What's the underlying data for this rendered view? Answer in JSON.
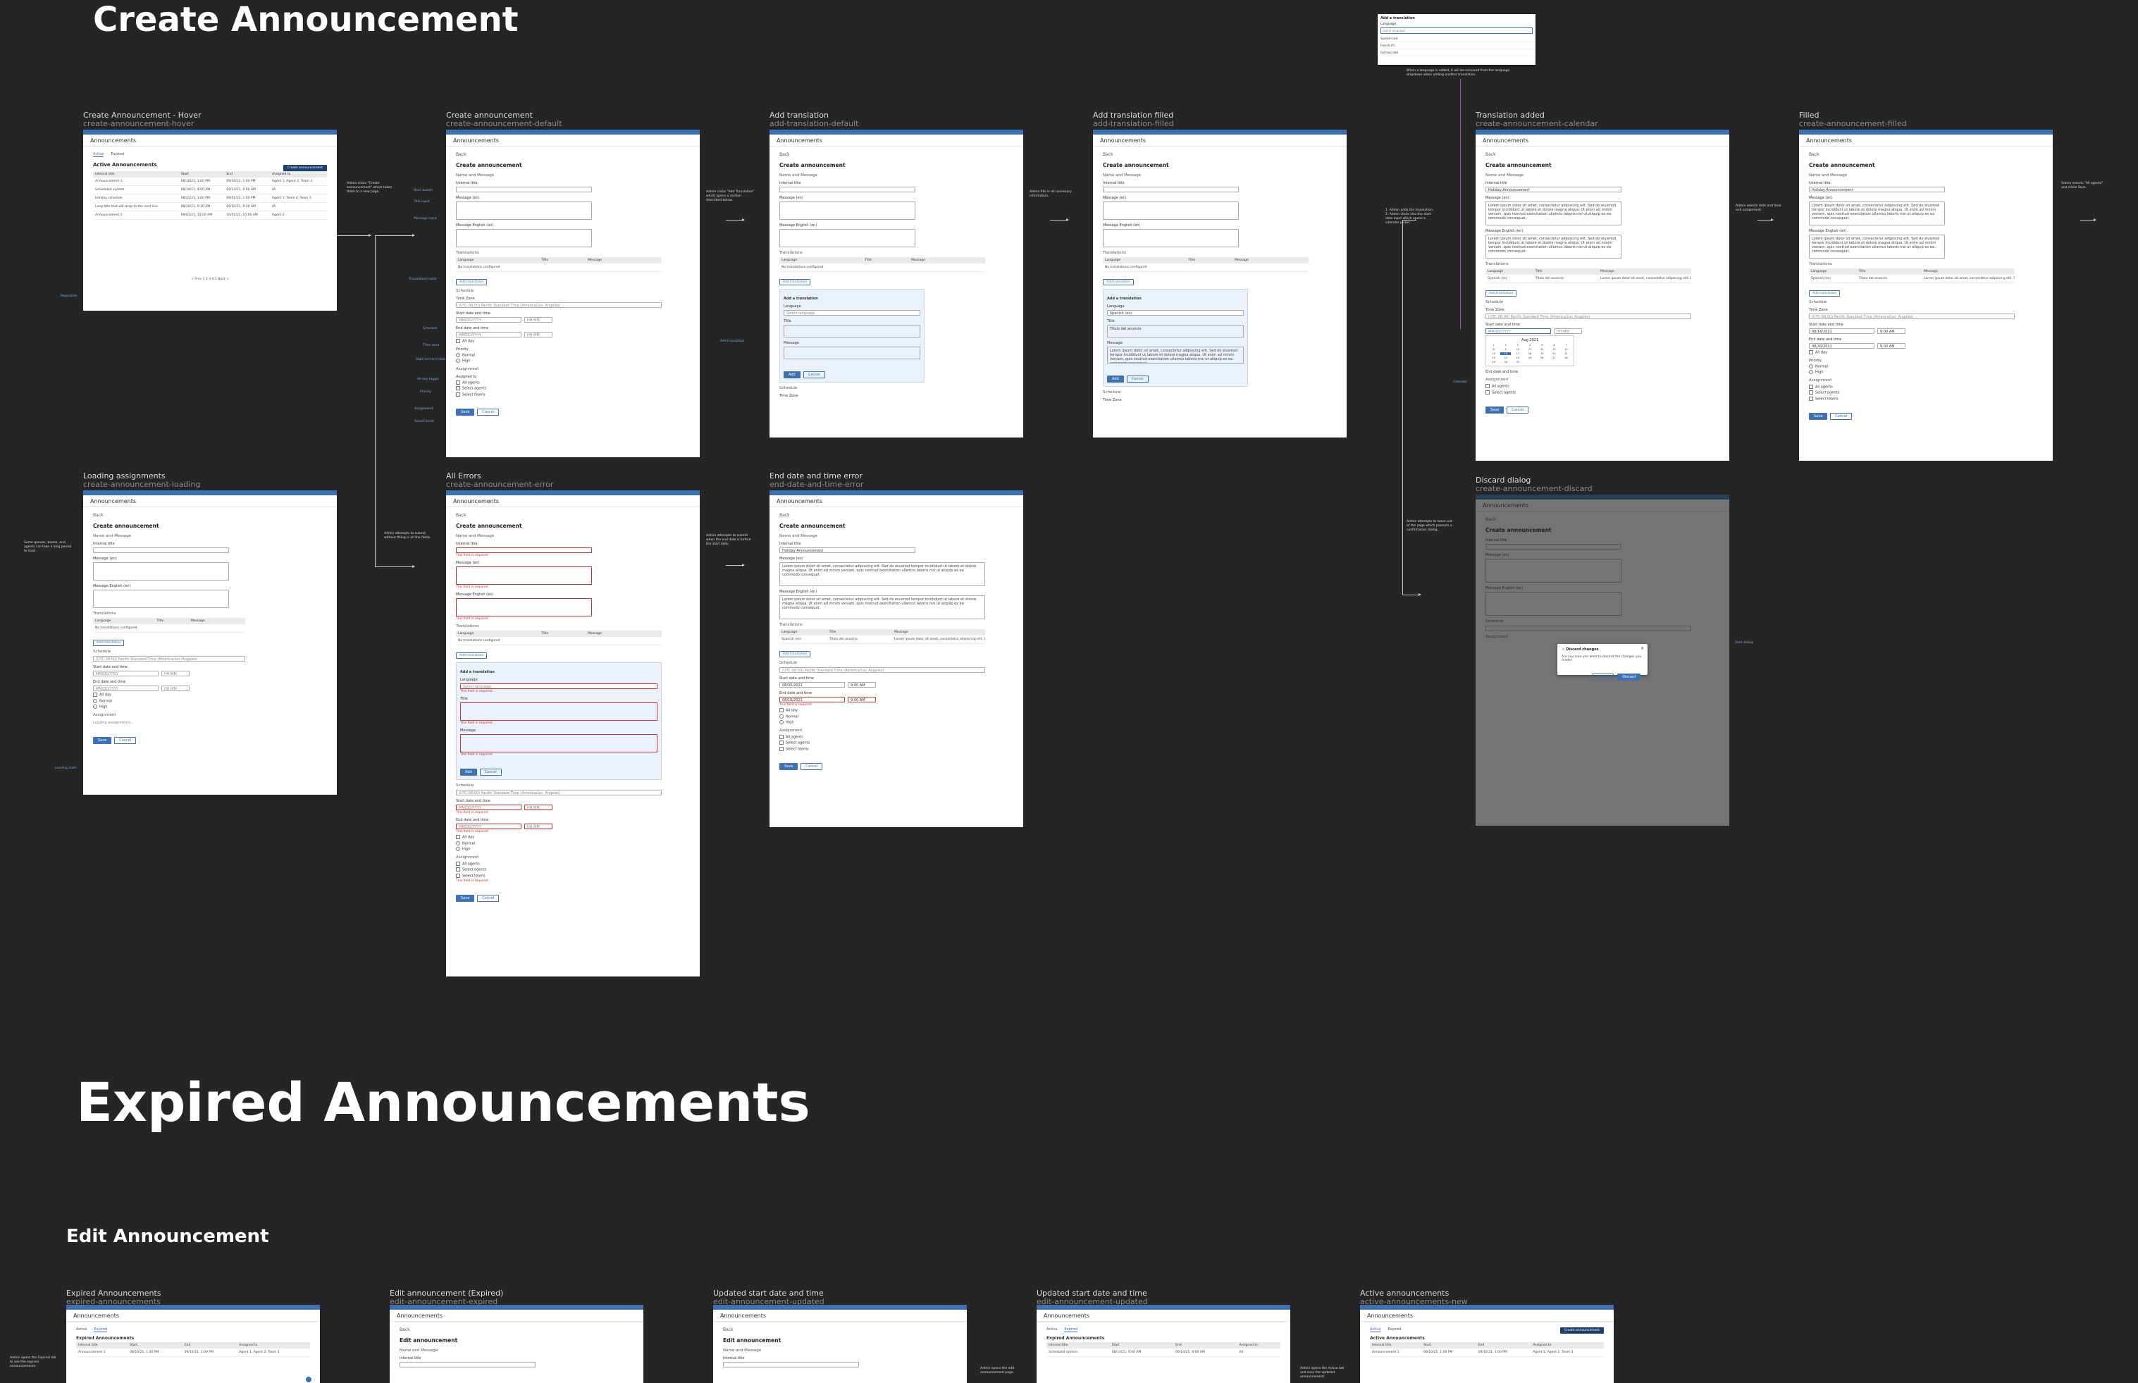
{
  "headings": {
    "create": "Create Announcement",
    "expired": "Expired Announcements",
    "edit": "Edit Announcement"
  },
  "common": {
    "page_title": "Announcements",
    "back": "Back",
    "create_title": "Create announcement",
    "edit_title": "Edit announcement",
    "name_message": "Name and Message",
    "internal_title": "Internal title",
    "message_en": "Message (en)",
    "message_english_en": "Message English (en)",
    "translations": "Translations",
    "col_language": "Language",
    "col_title": "Title",
    "col_message": "Message",
    "no_translations": "No translations configured",
    "add_translation_btn": "Add translation",
    "add_a_translation": "Add a translation",
    "language": "Language",
    "title": "Title",
    "message": "Message",
    "schedule": "Schedule",
    "time_zone": "Time Zone",
    "start_date": "Start date and time",
    "end_date": "End date and time",
    "all_day": "All day",
    "priority": "Priority",
    "normal": "Normal",
    "high": "High",
    "assignment": "Assignment",
    "assigned_to": "Assigned to",
    "all_agents": "All agents",
    "select_agents": "Select agents",
    "select_teams": "Select teams",
    "save": "Save",
    "cancel": "Cancel",
    "add": "Add",
    "required_error": "This field is required",
    "timezone_value": "(UTC-08:00) Pacific Standard Time (America/Los_Angeles)",
    "date_ph": "MM/DD/YYYY",
    "time_ph": "HH:MM",
    "loading_assignments": "Loading assignments..."
  },
  "list": {
    "tabs": [
      "Active",
      "Expired"
    ],
    "active_title": "Active Announcements",
    "expired_title": "Expired Announcements",
    "create_btn": "Create announcement",
    "headers": [
      "Internal title",
      "Start",
      "End",
      "Assigned to"
    ],
    "rows": [
      [
        "Announcement 1",
        "08/10/21, 1:00 PM",
        "09/10/21, 1:00 PM",
        "Agent 1, Agent 2, Team 3"
      ],
      [
        "Scheduled system",
        "08/14/21, 9:00 AM",
        "09/14/21, 9:00 AM",
        "All"
      ],
      [
        "Holiday schedule",
        "08/21/21, 1:00 PM",
        "09/01/21, 1:00 PM",
        "Agent 1, Team 4, Team 5"
      ],
      [
        "Long title that will wrap to the next line",
        "08/30/21, 9:30 AM",
        "09/30/21, 9:30 AM",
        "All"
      ],
      [
        "Announcement 5",
        "09/01/21, 10:00 AM",
        "10/01/21, 10:00 AM",
        "Agent 2"
      ]
    ],
    "pagination": "< Prev  1  2  3  4  5  Next >"
  },
  "frames": [
    {
      "title": "Create Announcement - Hover",
      "slug": "create-announcement-hover"
    },
    {
      "title": "Create announcement",
      "slug": "create-announcement-default"
    },
    {
      "title": "Add translation",
      "slug": "add-translation-default"
    },
    {
      "title": "Add translation filled",
      "slug": "add-translation-filled"
    },
    {
      "title": "Translation added",
      "slug": "create-announcement-calendar"
    },
    {
      "title": "Filled",
      "slug": "create-announcement-filled"
    },
    {
      "title": "Loading assignments",
      "slug": "create-announcement-loading"
    },
    {
      "title": "All Errors",
      "slug": "create-announcement-error"
    },
    {
      "title": "End date and time error",
      "slug": "end-date-and-time-error"
    },
    {
      "title": "Discard dialog",
      "slug": "create-announcement-discard"
    },
    {
      "title": "Expired Announcements",
      "slug": "expired-announcements"
    },
    {
      "title": "Edit announcement (Expired)",
      "slug": "edit-announcement-expired"
    },
    {
      "title": "Updated start date and time",
      "slug": "edit-announcement-updated"
    },
    {
      "title": "Updated start date and time",
      "slug": "edit-announcement-updated"
    },
    {
      "title": "Active announcements",
      "slug": "active-announcements-new"
    }
  ],
  "filled": {
    "internal_title": "Holiday Announcement",
    "lorem": "Lorem ipsum dolor sit amet, consectetur adipiscing elit. Sed do eiusmod tempor incididunt ut labore et dolore magna aliqua. Ut enim ad minim veniam, quis nostrud exercitation ullamco laboris nisi ut aliquip ex ea commodo consequat.",
    "language_value": "Spanish (es)",
    "tr_title": "Título del anuncio",
    "start": "08/16/2021",
    "end": "08/30/2021",
    "time": "9:00 AM",
    "calendar_month": "Aug 2021"
  },
  "discard": {
    "title": "Discard changes",
    "message": "Are you sure you want to discard the changes you made?",
    "discard_btn": "Discard"
  },
  "language_dropdown": {
    "label": "Add a translation",
    "sublabel": "Language",
    "placeholder": "Select language",
    "options": [
      "Spanish (es)",
      "French (fr)",
      "German (de)"
    ]
  },
  "notes": {
    "hover": "Admin clicks \"Create announcement\" which takes them to a new page.",
    "default": "Admin clicks \"Add Translation\" which opens a section described below.",
    "add_tr": "Admin fills in all necessary information.",
    "tr_filled": "1. Admin adds the translation.\n2. Admin clicks into the start date input which opens a calendar picker.",
    "calendar": "Admin selects date and time and assignment.",
    "filled": "Admin selects \"All agents\" and clicks Save.",
    "loading": "Some queues, teams, and agents can take a long period to load.",
    "errors": "Admin attempts to submit without filling in all the fields.",
    "end_err": "Admin attempts to submit when the end date is before the start date.",
    "discard": "Admin attempts to leave out of the page which prompts a confirmation dialog.",
    "dropdown": "When a language is added, it will be removed from the language dropdown when adding another translation.",
    "expired": "Admin opens the Expired tab to see the expired announcements.",
    "edit_exp": "Admin opens the edit announcement page.",
    "active": "Admin opens the Active tab and sees the updated announcement."
  },
  "tags": {
    "pagination": "Pagination",
    "back": "Back button",
    "title_input": "Title input",
    "message_input": "Message Input",
    "translations_table": "Translations table",
    "add_translation": "Add translation",
    "schedule": "Schedule",
    "timezone": "Time zone",
    "start_end": "Start and end date",
    "all_day": "All day toggle",
    "priority": "Priority",
    "assignment": "Assignment",
    "save_cancel": "Save/Cancel",
    "loading": "Loading state",
    "dialog": "Alert dialog",
    "calendar": "Calendar"
  }
}
